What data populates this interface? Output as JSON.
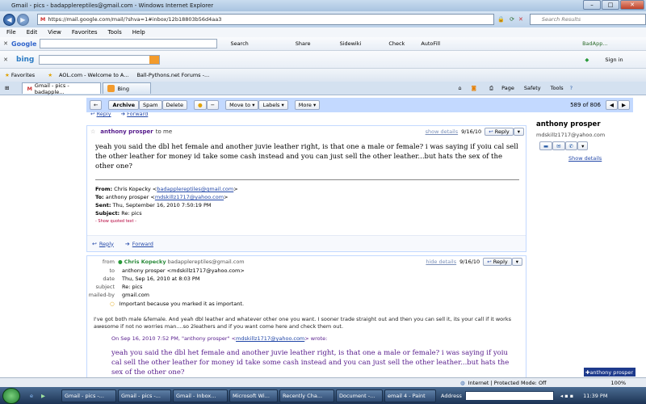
{
  "window": {
    "title": "Gmail - pics - badapplereptiles@gmail.com - Windows Internet Explorer",
    "url": "https://mail.google.com/mail/?shva=1#inbox/12b18803b56d4aa3",
    "search_placeholder": "Search Results"
  },
  "menu": [
    "File",
    "Edit",
    "View",
    "Favorites",
    "Tools",
    "Help"
  ],
  "google_toolbar": {
    "search": "Search",
    "share": "Share",
    "sidewiki": "Sidewiki",
    "check": "Check",
    "autofill": "AutoFill",
    "account": "BadApp...",
    "settings": "Sign in"
  },
  "bing_toolbar": {
    "label": "bing",
    "signin": "Sign in"
  },
  "favorites": {
    "label": "Favorites",
    "items": [
      "AOL.com - Welcome to A...",
      "Ball-Pythons.net Forums -..."
    ]
  },
  "tabs": [
    "Gmail - pics - badapple...",
    "Bing"
  ],
  "cmdbar": {
    "page": "Page",
    "safety": "Safety",
    "tools": "Tools"
  },
  "gmail": {
    "archive": "Archive",
    "spam": "Spam",
    "delete": "Delete",
    "move_to": "Move to",
    "labels": "Labels",
    "more": "More",
    "counter": "589 of 806",
    "reply": "Reply",
    "forward": "Forward"
  },
  "message1": {
    "sender": "anthony prosper",
    "to": "to me",
    "show_details": "show details",
    "date": "9/16/10",
    "reply_btn": "Reply",
    "body": "yeah you said the dbl het female and another juvie leather right, is that one a male or female? i was saying if yoiu cal sell the other leather for money id take some cash instead and you can just sell the other leather...but hats the sex of the other one?",
    "from_label": "From:",
    "from_value": "Chris Kopecky <",
    "from_email": "badapplereptiles@gmail.com",
    "to_label": "To:",
    "to_value": "anthony prosper <",
    "to_email": "mdskillz1717@yahoo.com",
    "sent_label": "Sent:",
    "sent_value": "Thu, September 16, 2010 7:50:19 PM",
    "subject_label": "Subject:",
    "subject_value": "Re: pics",
    "quoted": "- Show quoted text -"
  },
  "message2": {
    "from_label": "from",
    "sender": "Chris Kopecky",
    "sender_email": "badapplereptiles@gmail.com",
    "hide_details": "hide details",
    "date": "9/16/10",
    "reply_btn": "Reply",
    "to_label": "to",
    "to_value": "anthony prosper <mdskillz1717@yahoo.com>",
    "date_label": "date",
    "date_value": "Thu, Sep 16, 2010 at 8:03 PM",
    "subject_label": "subject",
    "subject_value": "Re: pics",
    "mailedby_label": "mailed-by",
    "mailedby_value": "gmail.com",
    "important": "Important because you marked it as important.",
    "body": "I've got both male &female. And yeah dbl leather and whatever other one you want. I sooner trade straight out and then you can sell it, its your call if it works awesome if not no worries man....so 2leathers and if you want come here and check them out.",
    "quote_intro": "On Sep 16, 2010 7:52 PM, \"anthony prosper\" <",
    "quote_email": "mdskillz1717@yahoo.com",
    "quote_intro_end": "> wrote:",
    "quote_body": "yeah you said the dbl het female and another juvie leather right, is that one a male or female? i was saying if yoiu cal sell the other leather for money id take some cash instead and you can just sell the other leather...but hats the sex of the other one?"
  },
  "contact": {
    "name": "anthony prosper",
    "email": "mdskillz1717@yahoo.com",
    "show_details": "Show details",
    "chat_tag": "anthony prosper"
  },
  "status": {
    "zone": "Internet | Protected Mode: Off",
    "zoom": "100%"
  },
  "taskbar": {
    "items": [
      "Gmail - pics -...",
      "Gmail - pics -...",
      "Gmail - Inbox...",
      "Microsoft Wi...",
      "Recently Cha...",
      "Document -...",
      "email 4 - Paint"
    ],
    "address_label": "Address",
    "time": "11:39 PM"
  }
}
